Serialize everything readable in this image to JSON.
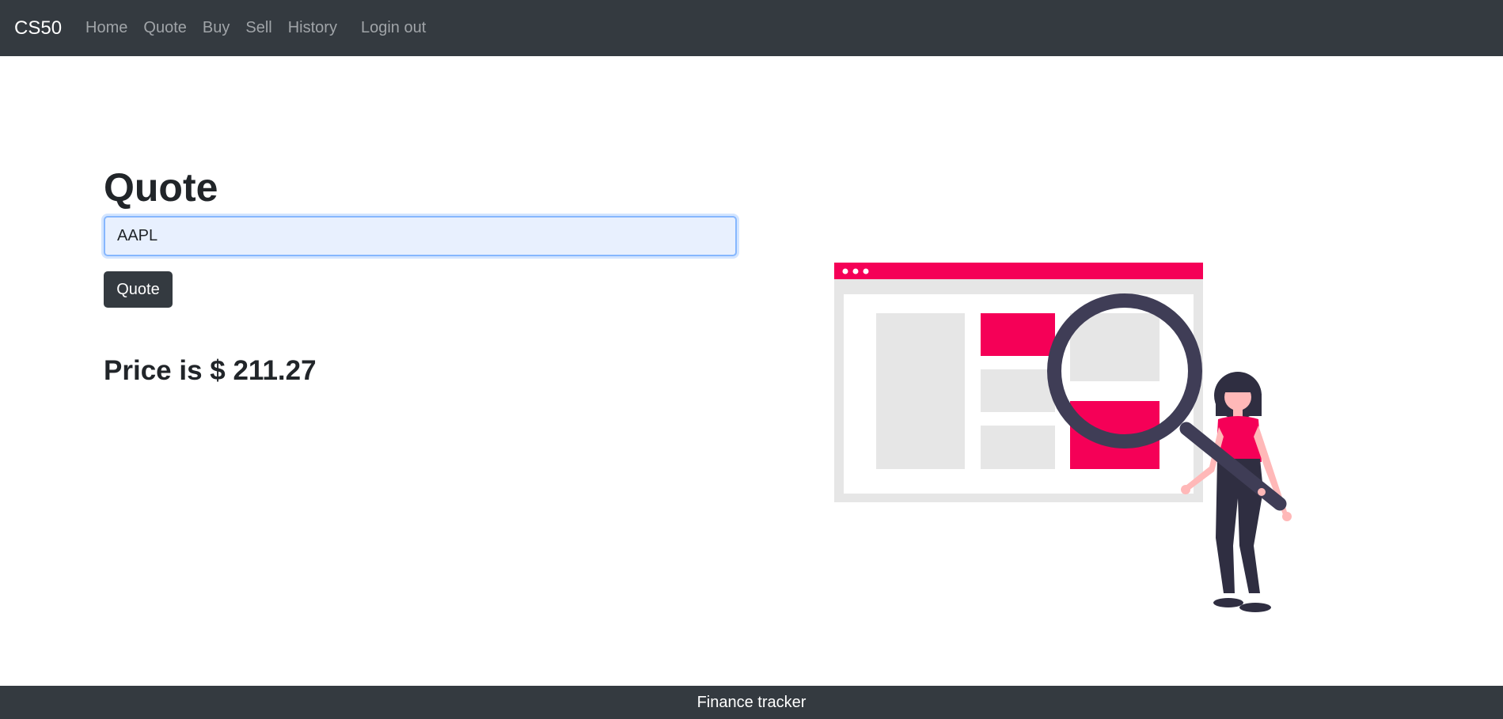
{
  "navbar": {
    "brand": "CS50",
    "links": [
      {
        "label": "Home"
      },
      {
        "label": "Quote"
      },
      {
        "label": "Buy"
      },
      {
        "label": "Sell"
      },
      {
        "label": "History"
      },
      {
        "label": "Login out"
      }
    ]
  },
  "main": {
    "title": "Quote",
    "symbol_input": {
      "value": "AAPL"
    },
    "submit_label": "Quote",
    "result": "Price is $ 211.27"
  },
  "illustration": {
    "icon": "magnifying-glass-search-illustration",
    "colors": {
      "accent": "#f50057",
      "dark": "#3f3d56",
      "panel": "#e6e6e6"
    }
  },
  "footer": {
    "text": "Finance tracker"
  },
  "colors": {
    "navbar_bg": "#343a40",
    "input_bg": "#e8f0fe",
    "input_border": "#86b7fe"
  }
}
